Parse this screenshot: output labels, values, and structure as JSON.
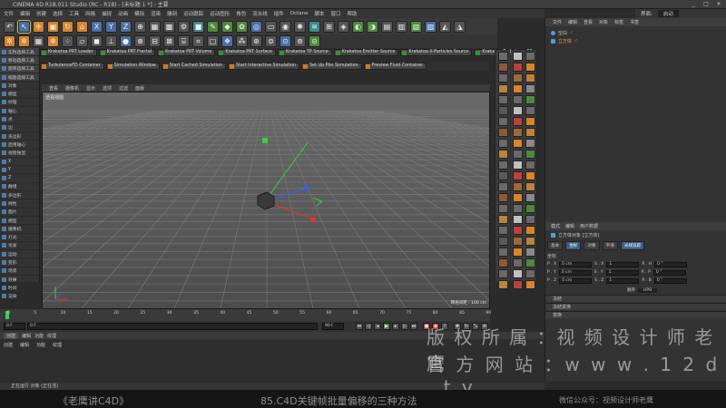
{
  "titlebar": {
    "title": "CINEMA 4D R18.011 Studio (RC - R18) - [未标题 1 *] - 主要"
  },
  "menubar": {
    "items": [
      "文件",
      "编辑",
      "创建",
      "选择",
      "工具",
      "网格",
      "捕捉",
      "动画",
      "模拟",
      "渲染",
      "雕刻",
      "运动跟踪",
      "运动图形",
      "角色",
      "流水线",
      "插件",
      "Octane",
      "脚本",
      "窗口",
      "帮助"
    ]
  },
  "layout": {
    "label": "界面:",
    "value": "启动"
  },
  "x4_buttons": [
    "Krakatoa PRT Loader",
    "Krakatoa PRT Fractal",
    "Krakatoa PRT Volume",
    "Krakatoa PRT Surface",
    "Krakatoa TP Source",
    "Krakatoa Emitter Source",
    "Krakatoa X-Particles Source",
    "Krakatoa TurbulenceFD"
  ],
  "tp_buttons": [
    "TurbulenceFD Container",
    "Simulation Window",
    "Start Cached Simulation",
    "Start Interactive Simulation",
    "Set Up Pbo Simulation",
    "Preview Fluid Container"
  ],
  "left_panel": {
    "items": [
      "实时选择工具",
      "移动选择工具",
      "旋转选择工具",
      "缩放选择工具",
      "对象",
      "模型",
      "纹理",
      "轴心",
      "点",
      "边",
      "多边形",
      "启用轴心",
      "视窗独显",
      "X",
      "Y",
      "Z",
      "群组",
      "多边形",
      "线性",
      "面片",
      "模型",
      "摄像机",
      "灯光",
      "毛发",
      "运动",
      "变形",
      "场景",
      "效果",
      "时间",
      "渲染"
    ]
  },
  "viewport": {
    "menu": [
      "查看",
      "摄像机",
      "显示",
      "选项",
      "过滤",
      "面板"
    ],
    "label": "透视视图",
    "grid_spacing": "网格间距 : 100 cm"
  },
  "timeline": {
    "ticks": [
      "0",
      "5",
      "10",
      "15",
      "20",
      "25",
      "30",
      "35",
      "40",
      "45",
      "50",
      "55",
      "60",
      "65",
      "70",
      "75",
      "80",
      "85",
      "90"
    ],
    "frame_current": "0 F",
    "frame_start": "0 F",
    "frame_end": "90 F",
    "frame_max": "90 F",
    "end_field": "0 F"
  },
  "timeline_panel": {
    "tabs": [
      "创建",
      "编辑",
      "功能",
      "纹理"
    ],
    "menu": [
      "创建",
      "编辑",
      "功能",
      "纹理"
    ]
  },
  "statusbar": {
    "text": "正在运行 对象 (正在活) "
  },
  "object_manager": {
    "tabs": [
      "文件",
      "编辑",
      "查看",
      "对象",
      "标签",
      "书签"
    ],
    "objects": [
      "空白",
      "立方体"
    ]
  },
  "attribute_manager": {
    "tabs": [
      "模式",
      "编辑",
      "用户数据"
    ],
    "object_label": "立方体对象 [立方体]",
    "subtabs": [
      "基本",
      "坐标",
      "对象",
      "平滑",
      "光线追踪"
    ],
    "section_label": "坐标",
    "fields": [
      {
        "axis": "P . X",
        "value": "0 cm",
        "s_axis": "S . X",
        "s_value": "1",
        "r_axis": "R . H",
        "r_value": "0 °"
      },
      {
        "axis": "P . Y",
        "value": "0 cm",
        "s_axis": "S . Y",
        "s_value": "1",
        "r_axis": "R . P",
        "r_value": "0 °"
      },
      {
        "axis": "P . Z",
        "value": "0 cm",
        "s_axis": "S . Z",
        "s_value": "1",
        "r_axis": "R . B",
        "r_value": "0 °"
      }
    ],
    "order_label": "顺序",
    "order_value": "HPB",
    "sections": [
      "冻结",
      "冻结变换",
      "变换"
    ]
  },
  "watermark": {
    "line1": "版 权 所 属 ：视 频 设 计 师 老 鹰",
    "line2": "官 方 网 站 ：w w w . 1 2 d . t v"
  },
  "caption": {
    "left": "《老鹰讲C4D》",
    "mid": "85.C4D关键帧批量偏移的三种方法",
    "right": "微信公众号：视频设计师老鹰"
  },
  "colors": {
    "viewport_top": "#6a6a6a",
    "viewport_bottom": "#4c4c4c",
    "axis_x": "#e8322b",
    "axis_y": "#39d04a",
    "axis_z": "#3e5ee8",
    "accent": "#4a6fa5"
  }
}
